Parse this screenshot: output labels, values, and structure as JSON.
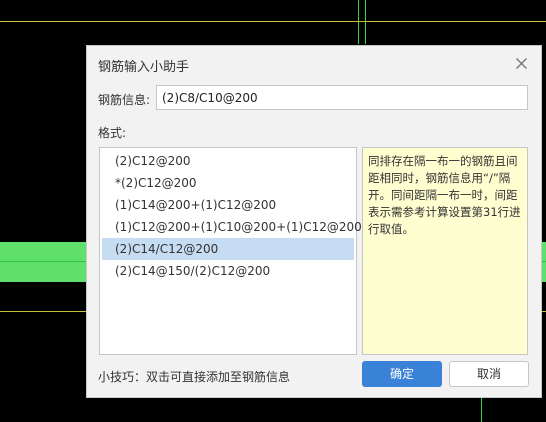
{
  "dialog": {
    "title": "钢筋输入小助手",
    "close_icon": "close-icon",
    "field_label": "钢筋信息:",
    "field_value": "(2)C8/C10@200",
    "format_label": "格式:",
    "formats": [
      "(2)C12@200",
      "*(2)C12@200",
      "(1)C14@200+(1)C12@200",
      "(1)C12@200+(1)C10@200+(1)C12@200",
      "(2)C14/C12@200",
      "(2)C14@150/(2)C12@200"
    ],
    "selected_index": 4,
    "tip_text": "同排存在隔一布一的钢筋且间距相同时，钢筋信息用“/”隔开。同间距隔一布一时，间距表示需参考计算设置第31行进行取值。",
    "hint": "小技巧：双击可直接添加至钢筋信息",
    "ok_label": "确定",
    "cancel_label": "取消"
  },
  "colors": {
    "canvas_bg": "#000000",
    "green_line": "#2fd84a",
    "green_band": "#5ee06b",
    "yellow_line": "#c9c23a",
    "dialog_bg": "#f2f2f2",
    "selection": "#c6dcf3",
    "tip_bg": "#fffed0",
    "primary": "#3a81d8"
  }
}
